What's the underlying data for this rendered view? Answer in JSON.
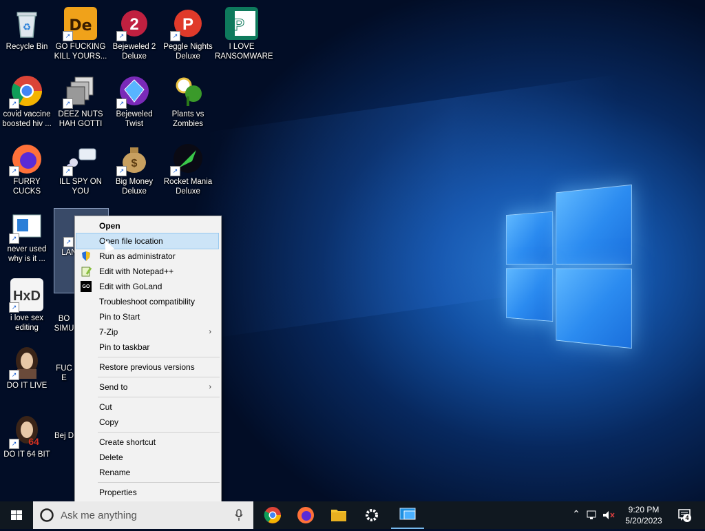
{
  "desktop": {
    "icons": [
      {
        "label": "Recycle Bin"
      },
      {
        "label": "GO FUCKING KILL YOURS..."
      },
      {
        "label": "Bejeweled 2 Deluxe"
      },
      {
        "label": "Peggle Nights Deluxe"
      },
      {
        "label": "I LOVE RANSOMWARE"
      },
      {
        "label": "covid vaccine boosted hiv ..."
      },
      {
        "label": "DEEZ NUTS HAH GOTTI"
      },
      {
        "label": "Bejeweled Twist"
      },
      {
        "label": "Plants vs Zombies"
      },
      {
        "label": "FURRY CUCKS"
      },
      {
        "label": "ILL SPY ON YOU"
      },
      {
        "label": "Big Money Deluxe"
      },
      {
        "label": "Rocket Mania Deluxe"
      },
      {
        "label": "never used why is it ..."
      },
      {
        "label": "LAN CAUS GO"
      },
      {
        "label": "i love sex editing"
      },
      {
        "label": "BO SIMU"
      },
      {
        "label": "DO IT LIVE"
      },
      {
        "label": "FUC E"
      },
      {
        "label": "DO IT 64 BIT"
      },
      {
        "label": "Bej D"
      }
    ]
  },
  "context_menu": {
    "items": [
      {
        "label": "Open"
      },
      {
        "label": "Open file location"
      },
      {
        "label": "Run as administrator"
      },
      {
        "label": "Edit with Notepad++"
      },
      {
        "label": "Edit with GoLand"
      },
      {
        "label": "Troubleshoot compatibility"
      },
      {
        "label": "Pin to Start"
      },
      {
        "label": "7-Zip"
      },
      {
        "label": "Pin to taskbar"
      },
      {
        "label": "Restore previous versions"
      },
      {
        "label": "Send to"
      },
      {
        "label": "Cut"
      },
      {
        "label": "Copy"
      },
      {
        "label": "Create shortcut"
      },
      {
        "label": "Delete"
      },
      {
        "label": "Rename"
      },
      {
        "label": "Properties"
      }
    ],
    "highlighted": "Open file location",
    "submenu_glyph": "›"
  },
  "taskbar": {
    "search_placeholder": "Ask me anything",
    "clock_time": "9:20 PM",
    "clock_date": "5/20/2023",
    "notification_count": "4",
    "apps": [
      "chrome",
      "firefox",
      "file-explorer",
      "settings",
      "remote-desktop"
    ]
  },
  "go_badge": "GO",
  "colors": {
    "menu_highlight": "#cce4f7",
    "taskbar": "#101820",
    "accent": "#76b9ed"
  }
}
